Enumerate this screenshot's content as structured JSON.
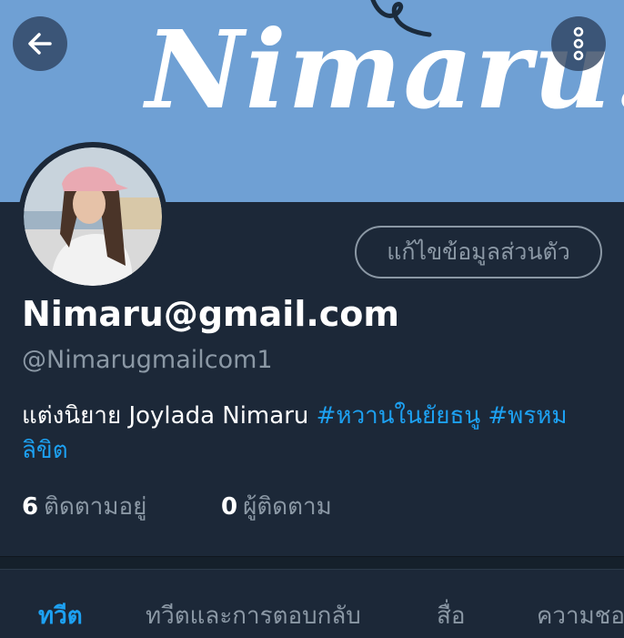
{
  "banner": {
    "title": "Nimaru."
  },
  "profile": {
    "edit_button_label": "แก้ไขข้อมูลส่วนตัว",
    "display_name": "Nimaru@gmail.com",
    "handle": "@Nimarugmailcom1",
    "bio_text": "แต่งนิยาย Joylada  Nimaru ",
    "bio_hashtag_1": "#หวานในยัยธนู",
    "bio_hashtag_2": "#พรหมลิขิต",
    "following_count": "6",
    "following_label": "ติดตามอยู่",
    "followers_count": "0",
    "followers_label": "ผู้ติดตาม"
  },
  "tabs": [
    {
      "label": "ทวีต",
      "active": true
    },
    {
      "label": "ทวีตและการตอบกลับ",
      "active": false
    },
    {
      "label": "สื่อ",
      "active": false
    },
    {
      "label": "ความชอบ",
      "active": false
    }
  ],
  "icons": {
    "back": "arrow-left-icon",
    "more": "more-vertical-icon"
  },
  "colors": {
    "accent": "#1da1f2",
    "background": "#1c2838",
    "banner": "#6fa0d4",
    "muted": "#8b98a5"
  }
}
